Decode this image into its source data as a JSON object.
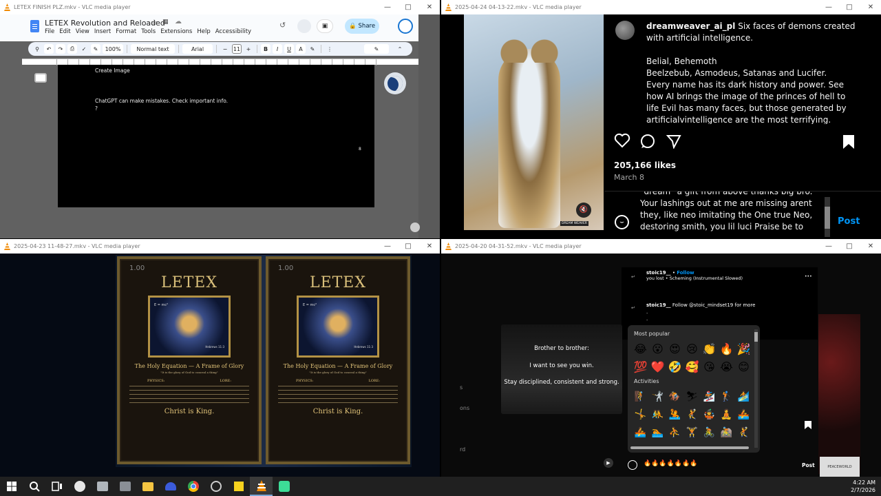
{
  "windows": {
    "tl": {
      "title": "LETEX FINISH PLZ.mkv - VLC media player"
    },
    "tr": {
      "title": "2025-04-24 04-13-22.mkv - VLC media player"
    },
    "bl": {
      "title": "2025-04-23 11-48-27.mkv - VLC media player"
    },
    "br": {
      "title": "2025-04-20 04-31-52.mkv - VLC media player"
    }
  },
  "docs": {
    "doc_title": "LETEX Revolution and Reloaded",
    "menu": [
      "File",
      "Edit",
      "View",
      "Insert",
      "Format",
      "Tools",
      "Extensions",
      "Help",
      "Accessibility"
    ],
    "share": "Share",
    "zoom": "100%",
    "style": "Normal text",
    "font": "Arial",
    "font_size": "11",
    "bold": "B",
    "italic": "I",
    "underline": "U",
    "textcolor": "A",
    "line1": "Create Image",
    "line2": "ChatGPT can make mistakes. Check important info.",
    "line3": "?",
    "pagenum": "8"
  },
  "instagram": {
    "username": "dreamweaver_ai_pl",
    "caption1": "Six faces of demons created with artificial intelligence.",
    "caption2": "Belial, Behemoth",
    "caption3": "Beelzebub, Asmodeus, Satanas and Lucifer.",
    "caption4": "Every name has its dark history and power. See how AI brings the image of the princes of hell to life Evil has many faces, but those generated by artificialvintelligence are the most terrifying.",
    "likes": "205,166 likes",
    "date": "March 8",
    "comment": "\"dream\" a gift from above thanks big bro. Your lashings out at me are missing arent they, like neo imitating the One true Neo, destoring smith, you lil luci Praise be to",
    "post": "Post",
    "watermark": "DREAM WEAVER"
  },
  "poster": {
    "badge": "1.00",
    "title": "LETEX",
    "heading": "The Holy Equation — A Frame of Glory",
    "quote": "\"It is the glory of God to conceal a thing\"",
    "physics": "PHYSICS:",
    "lore": "LORE:",
    "king": "Christ is King.",
    "eq": "E = mc²",
    "sig": "Hebrews 11:3"
  },
  "reel": {
    "user1": "stoic19__",
    "follow": "Follow",
    "song": "you lost • Scheming (Instrumental Slowed)",
    "user2": "stoic19__",
    "comment2": "Follow @stoic_mindset19 for more",
    "dot1": ".",
    "dot2": ".",
    "video1": "Brother to brother:",
    "video2": "I want to see you win.",
    "video3": "Stay disciplined, consistent and strong.",
    "most_popular": "Most popular",
    "activities": "Activities",
    "input": "🔥🔥🔥🔥🔥🔥🔥",
    "post": "Post",
    "side1": "s",
    "side2": "ons",
    "side3": "rd",
    "ad": "PEACEWORLD",
    "more": "•••",
    "emoji_row1": [
      "😂",
      "😮",
      "😍",
      "😢",
      "👏",
      "🔥",
      "🎉"
    ],
    "emoji_row2": [
      "💯",
      "❤️",
      "🤣",
      "🥰",
      "😘",
      "😭",
      "😊"
    ],
    "emoji_row3": [
      "🧗",
      "🤺",
      "🏇",
      "⛷",
      "🏂",
      "🏌",
      "🏄"
    ],
    "emoji_row4": [
      "🤸",
      "🤼",
      "🤽",
      "🤾",
      "🤹",
      "🧘",
      "🚣"
    ],
    "emoji_row5": [
      "🚣",
      "🏊",
      "⛹",
      "🏋",
      "🚴",
      "🚵",
      "🤾"
    ]
  },
  "taskbar": {
    "time": "4:22 AM",
    "date": "2/7/2026"
  },
  "colors": {
    "docs_blue": "#c2e7ff",
    "ig_bg": "#000000",
    "accent": "#0095f6",
    "taskbar": "#202020"
  }
}
